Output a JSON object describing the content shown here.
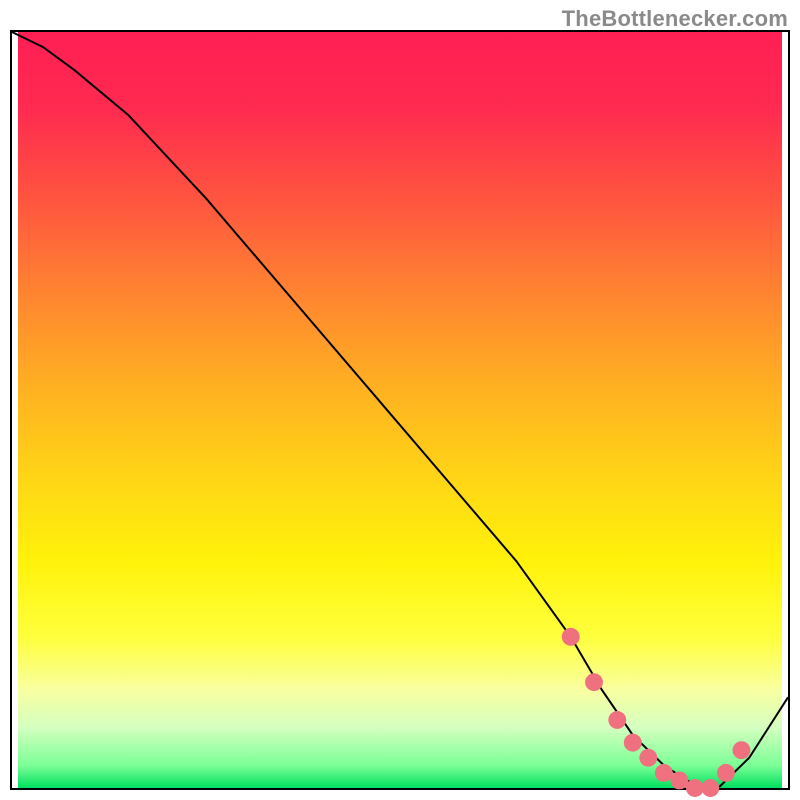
{
  "watermark": "TheBottlenecker.com",
  "chart_data": {
    "type": "line",
    "title": "",
    "xlabel": "",
    "ylabel": "",
    "xlim": [
      0,
      100
    ],
    "ylim": [
      0,
      100
    ],
    "series": [
      {
        "name": "bottleneck-curve",
        "x": [
          0,
          4,
          8,
          15,
          25,
          35,
          45,
          55,
          65,
          72,
          76,
          80,
          84,
          87,
          89,
          91,
          95,
          100
        ],
        "y": [
          100,
          98,
          95,
          89,
          78,
          66,
          54,
          42,
          30,
          20,
          13,
          7,
          3,
          1,
          0,
          0,
          4,
          12
        ]
      }
    ],
    "dots": {
      "name": "highlighted-range",
      "x": [
        72,
        75,
        78,
        80,
        82,
        84,
        86,
        88,
        90,
        92,
        94
      ],
      "y": [
        20,
        14,
        9,
        6,
        4,
        2,
        1,
        0,
        0,
        2,
        5
      ]
    },
    "gradient_stops": [
      {
        "pos": 0,
        "color": "#ff1f54"
      },
      {
        "pos": 35,
        "color": "#ff8630"
      },
      {
        "pos": 70,
        "color": "#fff20a"
      },
      {
        "pos": 100,
        "color": "#00e060"
      }
    ]
  }
}
